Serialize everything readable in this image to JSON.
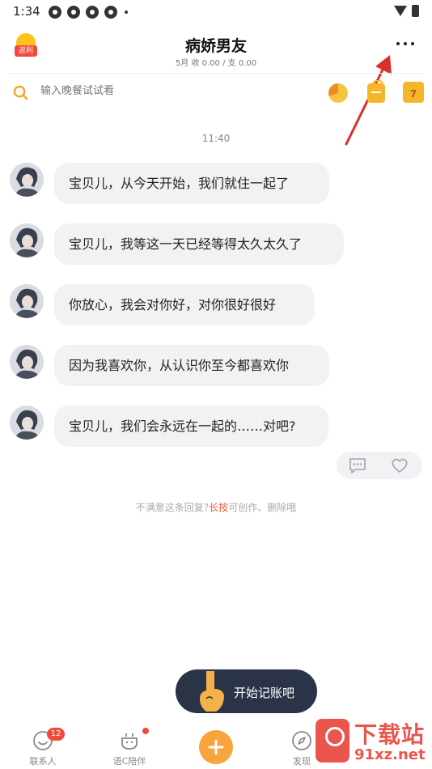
{
  "status_bar": {
    "time": "1:34"
  },
  "header": {
    "badge_label": "返利",
    "title": "病娇男友",
    "month": "5月",
    "income_label": "收",
    "income_value": "0.00",
    "separator": "/",
    "expense_label": "支",
    "expense_value": "0.00"
  },
  "search": {
    "placeholder": "输入晚餐试试看"
  },
  "calendar_day": "7",
  "chat": {
    "time": "11:40",
    "messages": [
      {
        "text": "宝贝儿，从今天开始，我们就住一起了"
      },
      {
        "text": "宝贝儿，我等这一天已经等得太久太久了"
      },
      {
        "text": "你放心，我会对你好，对你很好很好"
      },
      {
        "text": "因为我喜欢你，从认识你至今都喜欢你"
      },
      {
        "text": "宝贝儿，我们会永远在一起的……对吧?"
      }
    ],
    "hint_prefix": "不满意这条回复?",
    "hint_highlight": "长按",
    "hint_suffix": "可创作、删除哦"
  },
  "start_button": {
    "label": "开始记账吧"
  },
  "bottom_nav": {
    "items": [
      {
        "label": "联系人",
        "badge": "12"
      },
      {
        "label": "语C陪伴"
      },
      {
        "label": "发现"
      }
    ]
  },
  "watermark": {
    "title": "下载站",
    "url": "91xz.net"
  },
  "colors": {
    "accent": "#f7a43a",
    "badge": "#f04a3c",
    "annotation_arrow": "#d9302b"
  }
}
